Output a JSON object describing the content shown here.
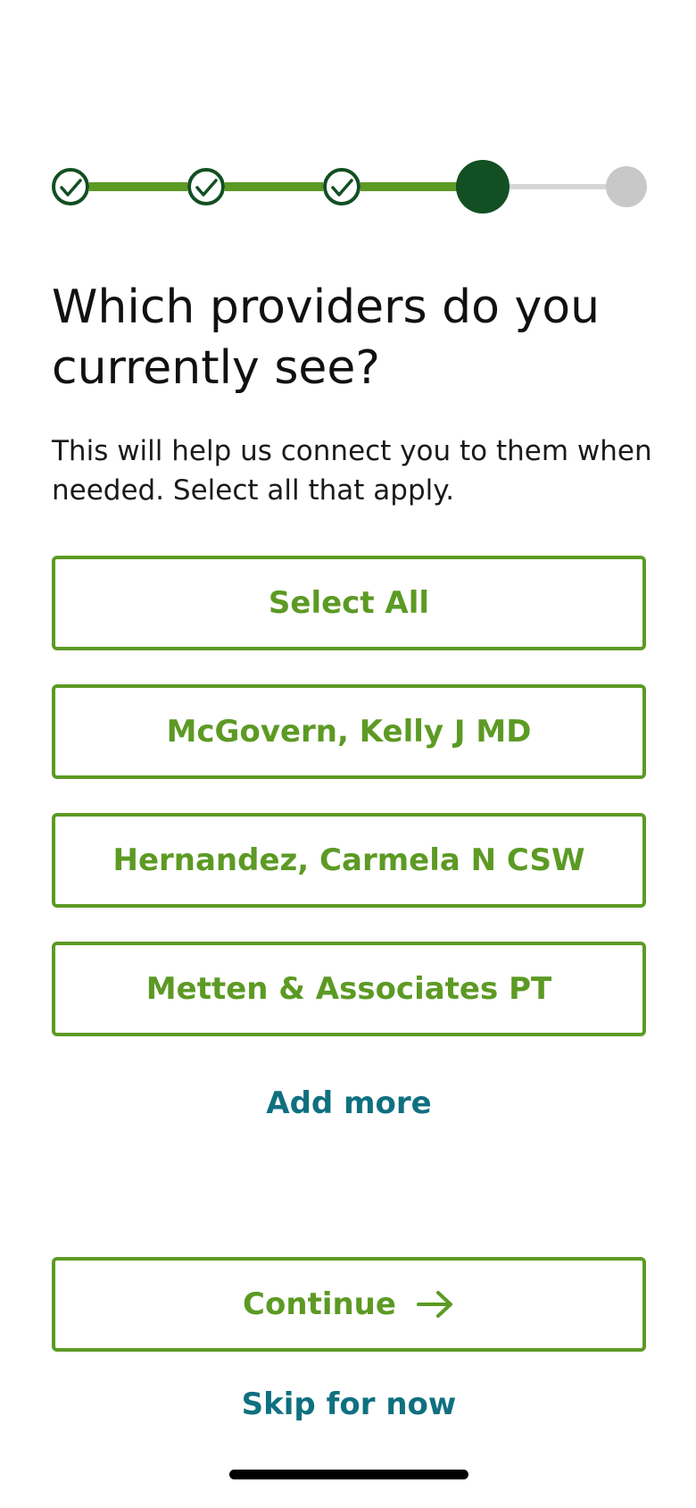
{
  "stepper": {
    "total_steps": 5,
    "current_step": 4,
    "completed_steps": 3,
    "colors": {
      "completed": "#5c9a24",
      "current": "#124f22",
      "upcoming": "#c8c8c8"
    },
    "icons": [
      "check-icon",
      "check-icon",
      "check-icon"
    ]
  },
  "title": "Which providers do you currently see?",
  "subtitle": "This will help us connect you to them when needed. Select all that apply.",
  "options": [
    {
      "label": "Select All"
    },
    {
      "label": "McGovern, Kelly J MD"
    },
    {
      "label": "Hernandez, Carmela N CSW"
    },
    {
      "label": "Metten & Associates PT"
    }
  ],
  "add_more_label": "Add more",
  "continue": {
    "label": "Continue",
    "icon": "arrow-right-icon"
  },
  "skip_label": "Skip for now",
  "colors": {
    "accent": "#5c9a24",
    "link": "#0f7080",
    "text": "#111111"
  }
}
